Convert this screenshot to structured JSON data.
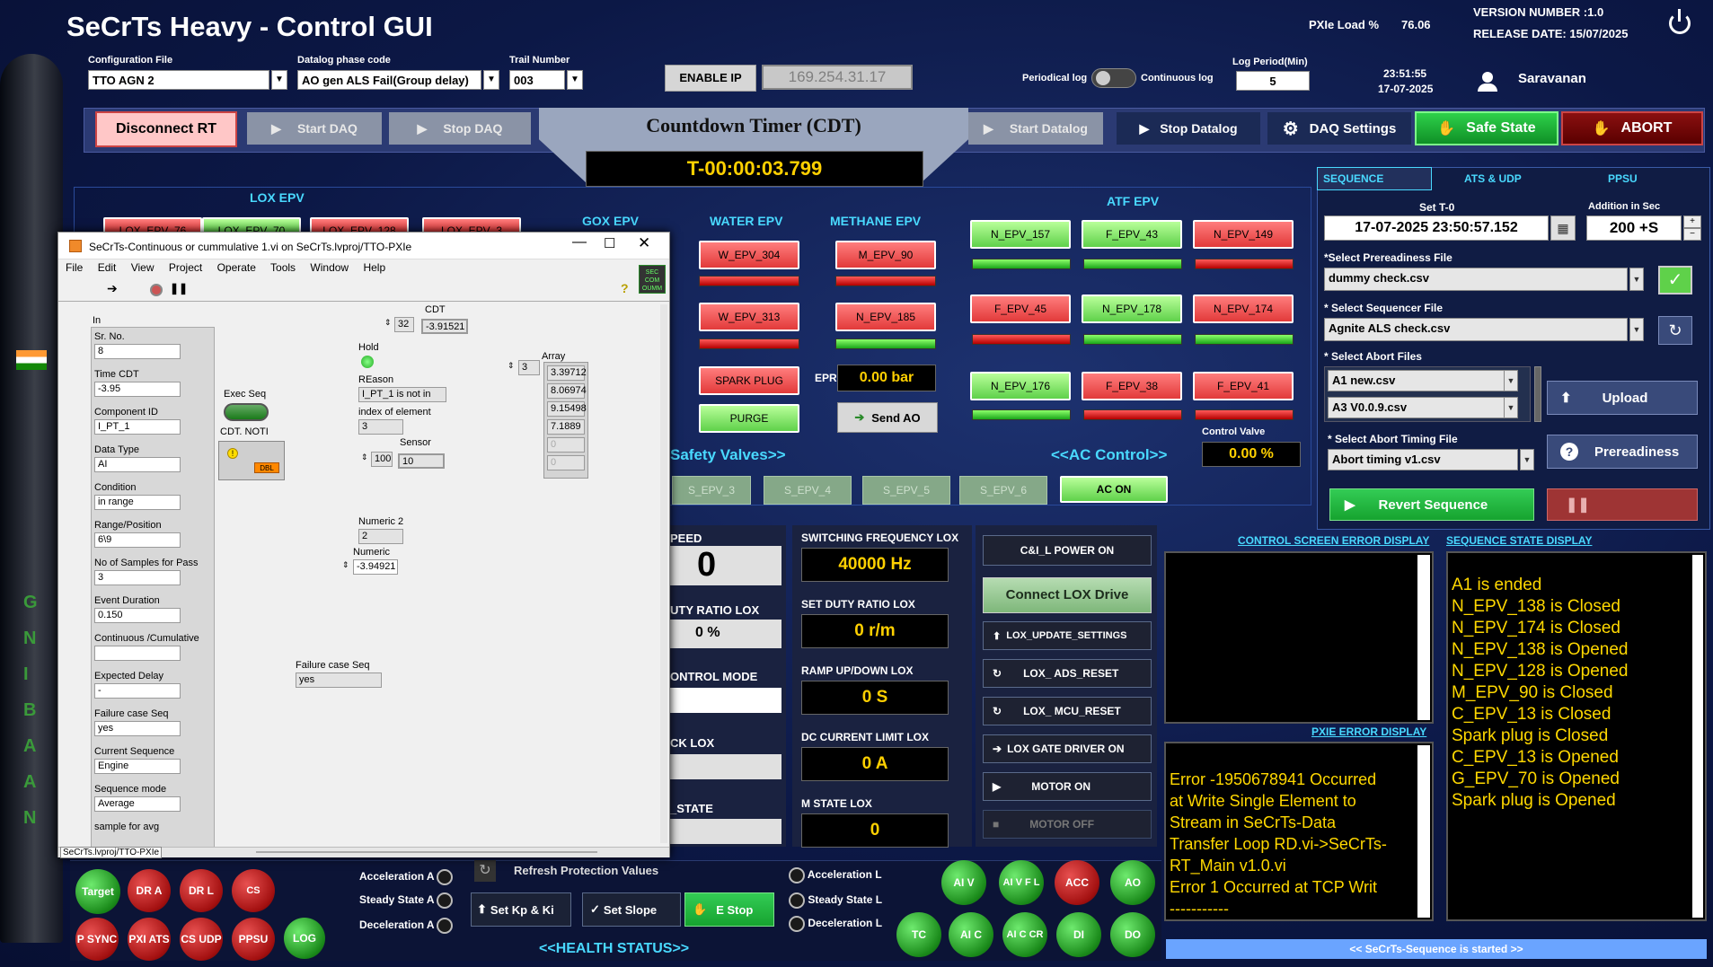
{
  "header": {
    "title": "SeCrTs Heavy - Control GUI",
    "pxie_load_label": "PXIe Load %",
    "pxie_load_value": "76.06",
    "version": "VERSION NUMBER :1.0",
    "release": "RELEASE DATE: 15/07/2025",
    "time": "23:51:55",
    "date": "17-07-2025",
    "user": "Saravanan"
  },
  "config": {
    "config_file_label": "Configuration File",
    "config_file": "TTO AGN 2",
    "datalog_label": "Datalog phase code",
    "datalog": "AO gen ALS Fail(Group delay)",
    "trail_label": "Trail Number",
    "trail": "003",
    "enable_ip": "ENABLE IP",
    "ip": "169.254.31.17",
    "periodic_log": "Periodical log",
    "continuous_log": "Continuous log",
    "log_period_label": "Log Period(Min)",
    "log_period": "5"
  },
  "toolbar": {
    "disconnect": "Disconnect RT",
    "start_daq": "Start DAQ",
    "stop_daq": "Stop DAQ",
    "cdt_title": "Countdown Timer (CDT)",
    "cdt_value": "T-00:00:03.799",
    "start_datalog": "Start Datalog",
    "stop_datalog": "Stop Datalog",
    "daq_settings": "DAQ  Settings",
    "safe_state": "Safe State",
    "abort": "ABORT"
  },
  "epv": {
    "lox_title": "LOX EPV",
    "gox_title": "GOX EPV",
    "water_title": "WATER EPV",
    "methane_title": "METHANE EPV",
    "atf_title": "ATF EPV",
    "lox_buttons": [
      "LOX_EPV_76",
      "LOX_EPV_70",
      "LOX_EPV_128",
      "LOX_EPV_3"
    ],
    "water": [
      "W_EPV_304",
      "W_EPV_313"
    ],
    "methane": [
      "M_EPV_90",
      "N_EPV_185"
    ],
    "spark_plug": "SPARK PLUG",
    "purge": "PURGE",
    "epr_label": "EPR",
    "epr_value": "0.00 bar",
    "send_ao": "Send AO",
    "atf": [
      {
        "label": "N_EPV_157",
        "color": "green"
      },
      {
        "label": "F_EPV_43",
        "color": "green"
      },
      {
        "label": "N_EPV_149",
        "color": "red"
      },
      {
        "label": "F_EPV_45",
        "color": "red"
      },
      {
        "label": "N_EPV_178",
        "color": "green"
      },
      {
        "label": "N_EPV_174",
        "color": "red"
      },
      {
        "label": "N_EPV_176",
        "color": "green"
      },
      {
        "label": "F_EPV_38",
        "color": "red"
      },
      {
        "label": "F_EPV_41",
        "color": "red"
      }
    ],
    "safety_valves": "Safety Valves>>",
    "ac_control": "<<AC Control>>",
    "control_valve_label": "Control Valve",
    "control_valve_value": "0.00 %",
    "s_epv": [
      "S_EPV_3",
      "S_EPV_4",
      "S_EPV_5",
      "S_EPV_6"
    ],
    "ac_on": "AC ON"
  },
  "labview": {
    "title": "SeCrTs-Continuous or cummulative 1.vi on SeCrTs.lvproj/TTO-PXIe",
    "menu": [
      "File",
      "Edit",
      "View",
      "Project",
      "Operate",
      "Tools",
      "Window",
      "Help"
    ],
    "in_label": "In",
    "fields": [
      {
        "label": "Sr. No.",
        "value": "8"
      },
      {
        "label": "Time CDT",
        "value": "-3.95"
      },
      {
        "label": "Component ID",
        "value": "I_PT_1"
      },
      {
        "label": "Data Type",
        "value": "AI"
      },
      {
        "label": "Condition",
        "value": "in range"
      },
      {
        "label": "Range/Position",
        "value": "6\\9"
      },
      {
        "label": "No of Samples for Pass",
        "value": "3"
      },
      {
        "label": "Event Duration",
        "value": "0.150"
      },
      {
        "label": "Continuous /Cumulative",
        "value": ""
      },
      {
        "label": "Expected Delay",
        "value": "-"
      },
      {
        "label": "Failure case Seq",
        "value": "yes"
      },
      {
        "label": "Current Sequence",
        "value": "Engine"
      },
      {
        "label": "Sequence  mode",
        "value": "Average"
      },
      {
        "label": "sample for avg",
        "value": ""
      }
    ],
    "exec_seq": "Exec Seq",
    "cdt_noti": "CDT. NOTI",
    "dbl": "DBL",
    "cdt_label": "CDT",
    "cdt_index": "32",
    "cdt_value": "-3.91521",
    "hold": "Hold",
    "reason_label": "REason",
    "reason_value": "I_PT_1 is not in",
    "index_label": "index of element",
    "index_value": "3",
    "sensor_label": "Sensor",
    "sensor_index": "100",
    "sensor_value": "10",
    "array_label": "Array",
    "array_index": "3",
    "array_values": [
      "3.39712",
      "8.06974",
      "9.15498",
      "7.1889",
      "0",
      "0"
    ],
    "numeric2_label": "Numeric 2",
    "numeric2_value": "2",
    "numeric_label": "Numeric",
    "numeric_value": "-3.94921",
    "failure_label": "Failure case Seq",
    "failure_value": "yes",
    "statusbar": "SeCrTs.lvproj/TTO-PXIe"
  },
  "motor": {
    "speed_label": "PEED",
    "speed_value": "0",
    "duty_label": "UTY RATIO LOX",
    "duty_value": "0 %",
    "control_mode": "ONTROL MODE",
    "ck_lox": "CK LOX",
    "state": "_STATE",
    "sw_freq_label": "SWITCHING FREQUENCY LOX",
    "sw_freq_value": "40000 Hz",
    "set_duty_label": "SET DUTY RATIO LOX",
    "set_duty_value": "0 r/m",
    "ramp_label": "RAMP UP/DOWN LOX",
    "ramp_value": "0 S",
    "dc_label": "DC CURRENT LIMIT LOX",
    "dc_value": "0 A",
    "m_state_label": "M STATE LOX",
    "m_state_value": "0",
    "buttons": [
      "C&I_L POWER ON",
      "Connect LOX Drive",
      "LOX_UPDATE_SETTINGS",
      "LOX_ ADS_RESET",
      "LOX_ MCU_RESET",
      "LOX GATE DRIVER ON",
      "MOTOR ON",
      "MOTOR OFF"
    ]
  },
  "sequence": {
    "tabs": [
      "SEQUENCE",
      "ATS & UDP",
      "PPSU"
    ],
    "set_t0_label": "Set  T-0",
    "set_t0": "17-07-2025 23:50:57.152",
    "addition_label": "Addition in Sec",
    "addition": "200 +S",
    "prereadiness_label": "*Select Prereadiness File",
    "prereadiness": "dummy check.csv",
    "sequencer_label": "* Select Sequencer File",
    "sequencer": "Agnite ALS check.csv",
    "abort_files_label": "* Select  Abort Files",
    "abort_files": [
      "A1 new.csv",
      "A3 V0.0.9.csv"
    ],
    "upload": "Upload",
    "abort_timing_label": "* Select Abort Timing File",
    "abort_timing": "Abort timing v1.csv",
    "prereadiness_btn": "Prereadiness",
    "revert": "Revert Sequence"
  },
  "logs": {
    "control_error_title": "CONTROL SCREEN ERROR DISPLAY",
    "seq_state_title": "SEQUENCE STATE DISPLAY",
    "pxie_error_title": "PXIE ERROR DISPLAY",
    "pxie_error_text": [
      "Error -1950678941 Occurred",
      "at  Write Single Element to",
      "Stream in SeCrTs-Data",
      "Transfer Loop RD.vi->SeCrTs-",
      "RT_Main v1.0.vi",
      "Error 1 Occurred at  TCP Writ",
      "-----------"
    ],
    "seq_state": [
      "A1 is ended",
      "N_EPV_138 is Closed",
      "N_EPV_174 is Closed",
      "N_EPV_138 is Opened",
      "N_EPV_128 is Opened",
      "M_EPV_90 is Closed",
      "C_EPV_13 is Closed",
      "Spark plug is Closed",
      "C_EPV_13 is Opened",
      "G_EPV_70 is Opened",
      "Spark plug is Opened"
    ],
    "status": "<< SeCrTs-Sequence is started >>"
  },
  "health": {
    "title": "<<HEALTH STATUS>>",
    "left_leds": [
      {
        "label": "Target",
        "color": "green"
      },
      {
        "label": "DR A",
        "color": "red"
      },
      {
        "label": "DR L",
        "color": "red"
      },
      {
        "label": "CS SYNC",
        "color": "red"
      },
      {
        "label": "P SYNC",
        "color": "red"
      },
      {
        "label": "PXI ATS",
        "color": "red"
      },
      {
        "label": "CS UDP",
        "color": "red"
      },
      {
        "label": "PPSU",
        "color": "red"
      },
      {
        "label": "LOG",
        "color": "green"
      }
    ],
    "accel_a": "Acceleration A",
    "steady_a": "Steady State A",
    "decel_a": "Deceleration A",
    "accel_l": "Acceleration L",
    "steady_l": "Steady State L",
    "decel_l": "Deceleration L",
    "refresh": "Refresh Protection Values",
    "set_kp": "Set Kp & Ki",
    "set_slope": "Set Slope",
    "e_stop": "E Stop",
    "right_leds": [
      {
        "label": "AI V",
        "color": "green"
      },
      {
        "label": "AI V F L",
        "color": "green"
      },
      {
        "label": "ACC",
        "color": "red"
      },
      {
        "label": "AO",
        "color": "green"
      },
      {
        "label": "TC",
        "color": "green"
      },
      {
        "label": "AI C",
        "color": "green"
      },
      {
        "label": "AI C CR",
        "color": "green"
      },
      {
        "label": "DI",
        "color": "green"
      },
      {
        "label": "DO",
        "color": "green"
      }
    ]
  },
  "rocket": {
    "letters": [
      "G",
      "N",
      "I",
      "B",
      "A",
      "A",
      "N"
    ]
  }
}
